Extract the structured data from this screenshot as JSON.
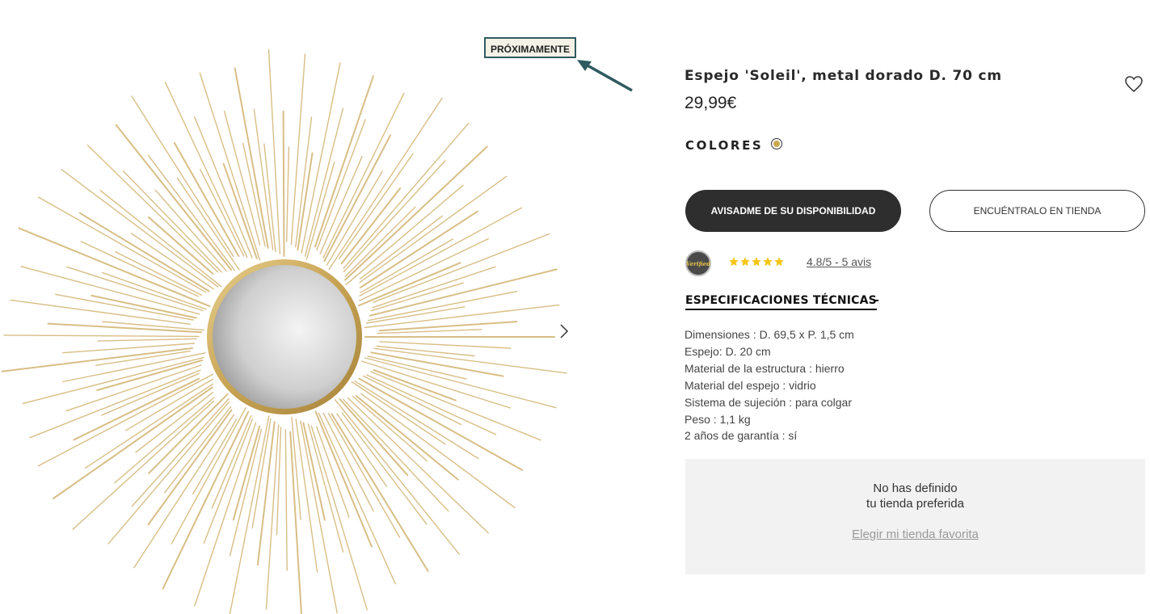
{
  "product": {
    "badge": "PRÓXIMAMENTE",
    "title": "Espejo 'Soleil', metal dorado D. 70 cm",
    "price": "29,99€",
    "colors_label": "COLORES",
    "swatch_color": "#c9a84f",
    "image_alt": "Espejo 'Soleil'"
  },
  "icons": {
    "wishlist": "heart-icon",
    "next": "chevron-right-icon",
    "annotation": "arrow-icon"
  },
  "actions": {
    "notify_label": "AVISADME DE SU DISPONIBILIDAD",
    "store_label": "ENCUÉNTRALO EN TIENDA"
  },
  "reviews": {
    "rating_text": "4.8/5 - 5 avis",
    "stars": 5,
    "star_color": "#f5c518",
    "logo_text": "Verified"
  },
  "specs": {
    "heading": "ESPECIFICACIONES TÉCNICAS",
    "toggle": "-",
    "items": [
      "Dimensiones : D. 69,5 x P. 1,5 cm",
      "Espejo: D. 20 cm",
      "Material de la estructura : hierro",
      "Material del espejo : vidrio",
      "Sistema de sujeción : para colgar",
      "Peso : 1,1 kg",
      "2 años de garantía : sí"
    ]
  },
  "store": {
    "message_line1": "No has definido",
    "message_line2": "tu tienda preferida",
    "link": "Elegir mi tienda favorita"
  },
  "colors": {
    "gold": "#d8be85",
    "dark_button": "#2e2e2e",
    "badge_border": "#2f5b60",
    "panel_bg": "#f2f2f2"
  }
}
